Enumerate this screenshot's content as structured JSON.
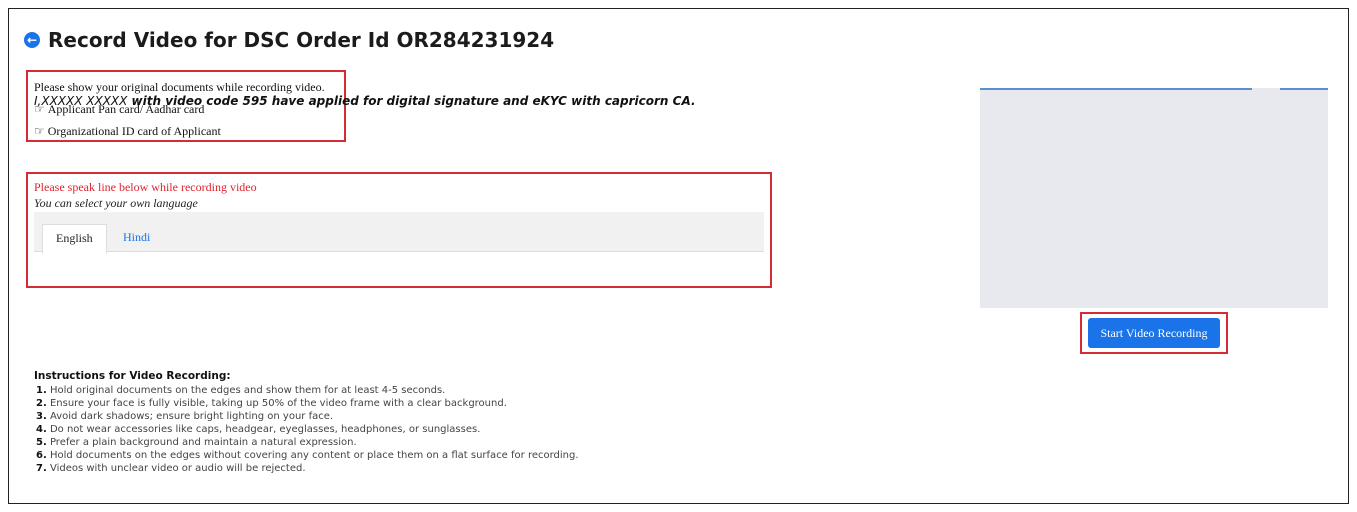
{
  "header": {
    "back_icon": "arrow-left-circle-icon",
    "title": "Record Video for DSC Order Id OR284231924"
  },
  "documents": {
    "intro": "Please show your original documents while recording video.",
    "items": [
      "Applicant Pan card/ Aadhar card",
      "Organizational ID card of Applicant"
    ],
    "bullet_icon": "pointing-hand-icon"
  },
  "speak": {
    "prompt": "Please speak line below while recording video",
    "language_note": "You can select your own language",
    "tabs": [
      {
        "label": "English",
        "active": true
      },
      {
        "label": "Hindi",
        "active": false
      }
    ],
    "name_placeholder": "I,XXXXX XXXXX",
    "statement": " with video code 595 have applied for digital signature and eKYC with capricorn CA."
  },
  "recorder": {
    "start_button": "Start Video Recording"
  },
  "instructions": {
    "heading": "Instructions for Video Recording:",
    "items": [
      {
        "num": "1.",
        "text": "Hold original documents on the edges and show them for at least 4-5 seconds."
      },
      {
        "num": "2.",
        "text": "Ensure your face is fully visible, taking up 50% of the video frame with a clear background."
      },
      {
        "num": "3.",
        "text": "Avoid dark shadows; ensure bright lighting on your face."
      },
      {
        "num": "4.",
        "text": "Do not wear accessories like caps, headgear, eyeglasses, headphones, or sunglasses."
      },
      {
        "num": "5.",
        "text": "Prefer a plain background and maintain a natural expression."
      },
      {
        "num": "6.",
        "text": "Hold documents on the edges without covering any content or place them on a flat surface for recording."
      },
      {
        "num": "7.",
        "text": "Videos with unclear video or audio will be rejected."
      }
    ]
  },
  "colors": {
    "highlight_red": "#d62b34",
    "accent_blue": "#1a73e8",
    "prompt_red": "#e0232d"
  }
}
